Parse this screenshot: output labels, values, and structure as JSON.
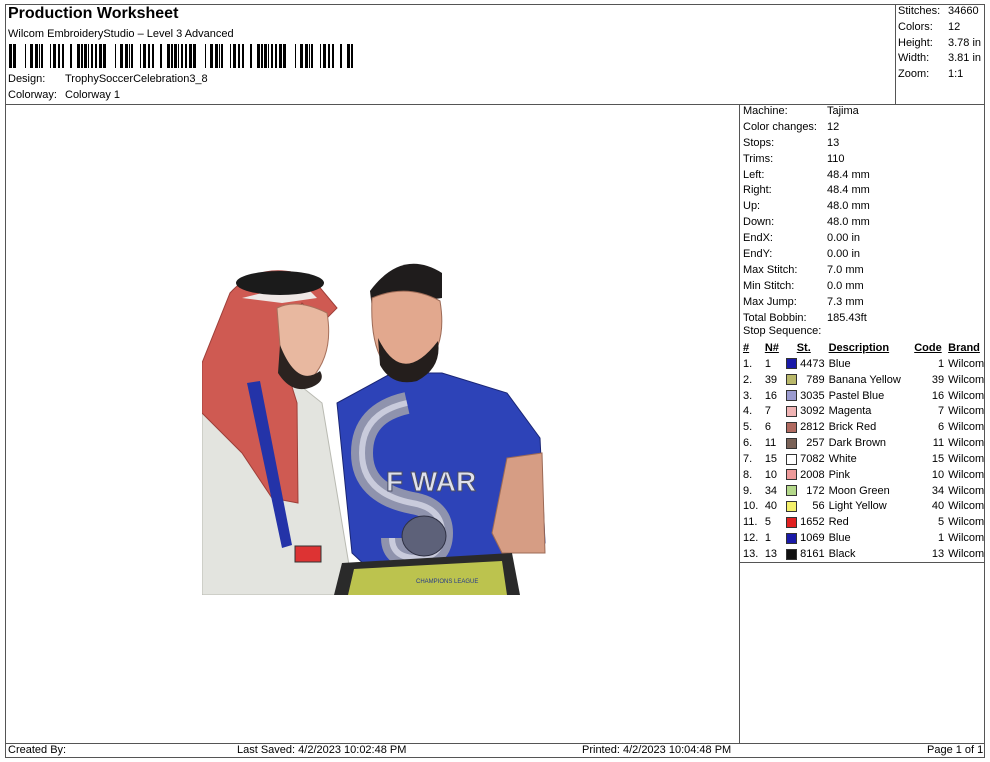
{
  "header": {
    "title": "Production Worksheet",
    "software": "Wilcom EmbroideryStudio – Level 3 Advanced",
    "design_label": "Design:",
    "design_value": "TrophySoccerCelebration3_8",
    "colorway_label": "Colorway:",
    "colorway_value": "Colorway 1"
  },
  "summary": [
    {
      "label": "Stitches:",
      "value": "34660"
    },
    {
      "label": "Colors:",
      "value": "12"
    },
    {
      "label": "Height:",
      "value": "3.78 in"
    },
    {
      "label": "Width:",
      "value": "3.81 in"
    },
    {
      "label": "Zoom:",
      "value": "1:1"
    }
  ],
  "specs": [
    {
      "label": "Machine:",
      "value": "Tajima"
    },
    {
      "label": "Color changes:",
      "value": "12"
    },
    {
      "label": "Stops:",
      "value": "13"
    },
    {
      "label": "Trims:",
      "value": "110"
    },
    {
      "label": "Left:",
      "value": "48.4 mm"
    },
    {
      "label": "Right:",
      "value": "48.4 mm"
    },
    {
      "label": "Up:",
      "value": "48.0 mm"
    },
    {
      "label": "Down:",
      "value": "48.0 mm"
    },
    {
      "label": "EndX:",
      "value": "0.00 in"
    },
    {
      "label": "EndY:",
      "value": "0.00 in"
    },
    {
      "label": "Max Stitch:",
      "value": "7.0 mm"
    },
    {
      "label": "Min Stitch:",
      "value": "0.0 mm"
    },
    {
      "label": "Max Jump:",
      "value": "7.3 mm"
    },
    {
      "label": "Total Bobbin:",
      "value": "185.43ft"
    }
  ],
  "stop_sequence": {
    "title": "Stop Sequence:",
    "headers": {
      "idx": "#",
      "num": "N#",
      "st": "St.",
      "desc": "Description",
      "code": "Code",
      "brand": "Brand"
    },
    "rows": [
      {
        "idx": "1.",
        "num": "1",
        "color": "#1a1aa8",
        "st": "4473",
        "desc": "Blue",
        "code": "1",
        "brand": "Wilcom"
      },
      {
        "idx": "2.",
        "num": "39",
        "color": "#b9b86a",
        "st": "789",
        "desc": "Banana Yellow",
        "code": "39",
        "brand": "Wilcom"
      },
      {
        "idx": "3.",
        "num": "16",
        "color": "#9b9bd0",
        "st": "3035",
        "desc": "Pastel Blue",
        "code": "16",
        "brand": "Wilcom"
      },
      {
        "idx": "4.",
        "num": "7",
        "color": "#f0b4b4",
        "st": "3092",
        "desc": "Magenta",
        "code": "7",
        "brand": "Wilcom"
      },
      {
        "idx": "5.",
        "num": "6",
        "color": "#b06a60",
        "st": "2812",
        "desc": "Brick Red",
        "code": "6",
        "brand": "Wilcom"
      },
      {
        "idx": "6.",
        "num": "11",
        "color": "#7a6257",
        "st": "257",
        "desc": "Dark Brown",
        "code": "11",
        "brand": "Wilcom"
      },
      {
        "idx": "7.",
        "num": "15",
        "color": "#ffffff",
        "st": "7082",
        "desc": "White",
        "code": "15",
        "brand": "Wilcom"
      },
      {
        "idx": "8.",
        "num": "10",
        "color": "#ee9a9a",
        "st": "2008",
        "desc": "Pink",
        "code": "10",
        "brand": "Wilcom"
      },
      {
        "idx": "9.",
        "num": "34",
        "color": "#b4d88a",
        "st": "172",
        "desc": "Moon Green",
        "code": "34",
        "brand": "Wilcom"
      },
      {
        "idx": "10.",
        "num": "40",
        "color": "#f4f06a",
        "st": "56",
        "desc": "Light Yellow",
        "code": "40",
        "brand": "Wilcom"
      },
      {
        "idx": "11.",
        "num": "5",
        "color": "#e02020",
        "st": "1652",
        "desc": "Red",
        "code": "5",
        "brand": "Wilcom"
      },
      {
        "idx": "12.",
        "num": "1",
        "color": "#1a1aa8",
        "st": "1069",
        "desc": "Blue",
        "code": "1",
        "brand": "Wilcom"
      },
      {
        "idx": "13.",
        "num": "13",
        "color": "#111111",
        "st": "8161",
        "desc": "Black",
        "code": "13",
        "brand": "Wilcom"
      }
    ]
  },
  "footer": {
    "created_by": "Created By:",
    "last_saved": "Last Saved: 4/2/2023 10:02:48 PM",
    "printed": "Printed: 4/2/2023 10:04:48 PM",
    "page": "Page 1 of 1"
  },
  "artwork": {
    "trophy_text": "F WAR",
    "plaque_text": "CHAMPIONS LEAGUE"
  }
}
